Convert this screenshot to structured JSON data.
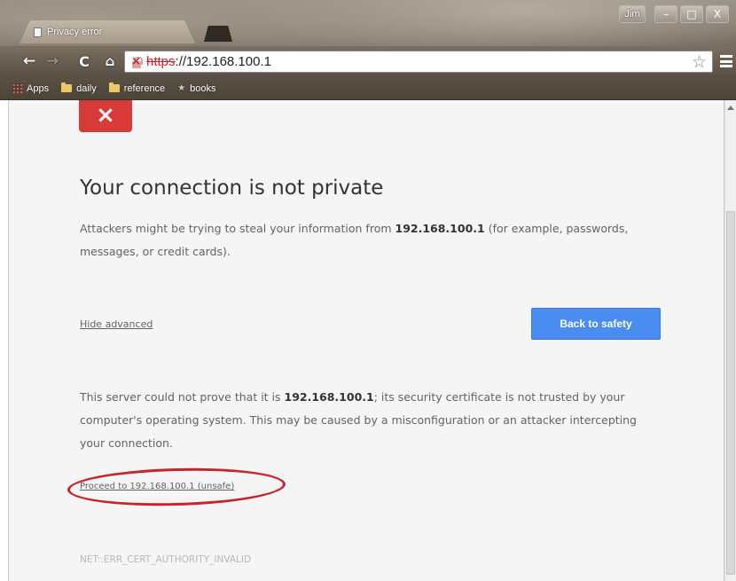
{
  "browser": {
    "tab_title": "Privacy error",
    "user_button": "Jim",
    "window_controls": {
      "minimize": "–",
      "maximize": "□",
      "close": "X"
    },
    "nav": {
      "back": "←",
      "forward": "→",
      "reload": "C",
      "home": "⌂"
    },
    "address": {
      "scheme": "https",
      "rest": "://192.168.100.1",
      "security_state": "not-secure"
    },
    "bookmarks": [
      {
        "label": "Apps",
        "icon": "apps-grid-icon"
      },
      {
        "label": "daily",
        "icon": "folder-icon"
      },
      {
        "label": "reference",
        "icon": "folder-icon"
      },
      {
        "label": "books",
        "icon": "star-icon"
      }
    ]
  },
  "page": {
    "error_icon": "×",
    "heading": "Your connection is not private",
    "intro": {
      "before": "Attackers might be trying to steal your information from ",
      "host": "192.168.100.1",
      "after": " (for example, passwords, messages, or credit cards)."
    },
    "hide_advanced": "Hide advanced",
    "back_to_safety": "Back to safety",
    "details": {
      "before": "This server could not prove that it is ",
      "host": "192.168.100.1",
      "after": "; its security certificate is not trusted by your computer's operating system. This may be caused by a misconfiguration or an attacker intercepting your connection."
    },
    "proceed_link": "Proceed to 192.168.100.1 (unsafe)",
    "error_code": "NET::ERR_CERT_AUTHORITY_INVALID"
  },
  "colors": {
    "primary_button": "#4a8cf0",
    "error_red": "#d83a3a",
    "annotation_circle": "#c9242b"
  }
}
